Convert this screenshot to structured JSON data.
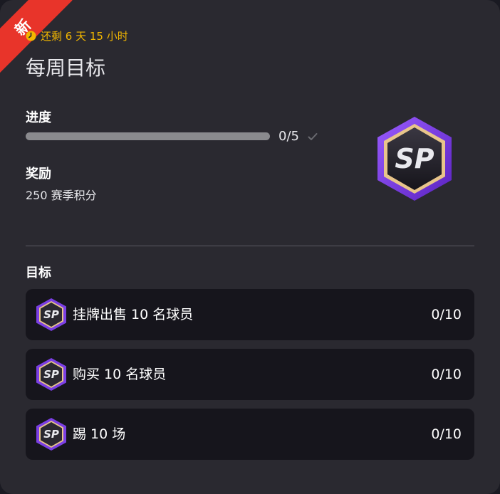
{
  "badge": {
    "new_label": "新"
  },
  "timer": {
    "text": "还剩 6 天 15 小时",
    "icon": "clock-icon"
  },
  "title": "每周目标",
  "progress": {
    "label": "进度",
    "text": "0/5",
    "fraction": 0
  },
  "reward": {
    "label": "奖励",
    "text": "250 赛季积分",
    "badge_text": "SP"
  },
  "objectives": {
    "label": "目标",
    "items": [
      {
        "label": "挂牌出售 10 名球员",
        "count": "0/10",
        "badge_text": "SP"
      },
      {
        "label": "购买 10 名球员",
        "count": "0/10",
        "badge_text": "SP"
      },
      {
        "label": "踢 10 场",
        "count": "0/10",
        "badge_text": "SP"
      }
    ]
  },
  "colors": {
    "accent_yellow": "#f2b600",
    "ribbon_red": "#e8342a",
    "badge_purple": "#7b3fe4",
    "badge_gold": "#e8c58a",
    "card_bg": "#2a2930",
    "row_bg": "#16151c"
  }
}
